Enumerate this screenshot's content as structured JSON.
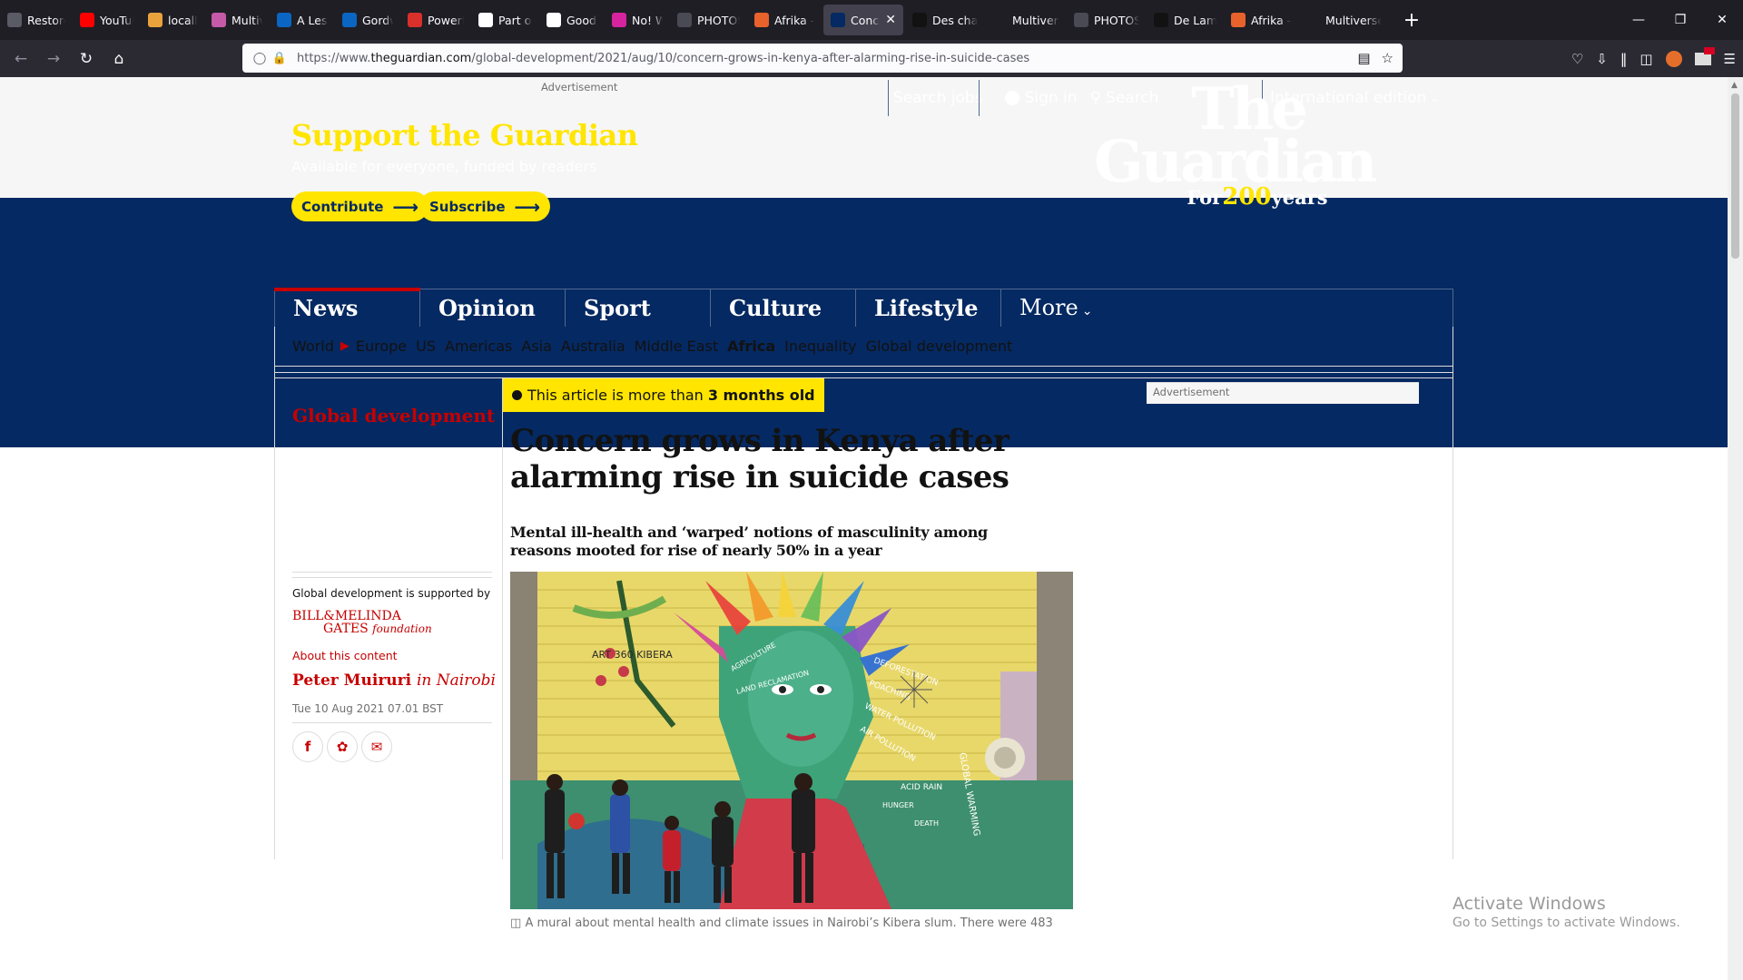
{
  "browser": {
    "tabs": [
      {
        "label": "Restore S",
        "icon": "info-icon",
        "color": "#5b5b66"
      },
      {
        "label": "YouTube",
        "icon": "youtube-icon",
        "color": "#ff0000"
      },
      {
        "label": "localhos",
        "icon": "localhost-icon",
        "color": "#e8a33d"
      },
      {
        "label": "Multiver",
        "icon": "multiverse-icon",
        "color": "#c659a8"
      },
      {
        "label": "A Lesson",
        "icon": "linkedin-icon",
        "color": "#0a66c2"
      },
      {
        "label": "Gordwin",
        "icon": "linkedin-icon",
        "color": "#0a66c2"
      },
      {
        "label": "Powerfu",
        "icon": "red-logo-icon",
        "color": "#d9302c"
      },
      {
        "label": "Part one",
        "icon": "medium-icon",
        "color": "#ffffff"
      },
      {
        "label": "Good Ne",
        "icon": "gc-icon",
        "color": "#ffffff"
      },
      {
        "label": "No! Wah",
        "icon": "instagram-icon",
        "color": "#d6249f"
      },
      {
        "label": "PHOTOS",
        "icon": "photos-icon",
        "color": "#4a4a55"
      },
      {
        "label": "Afrika - I",
        "icon": "blogger-icon",
        "color": "#e8622c"
      },
      {
        "label": "Conce",
        "icon": "guardian-icon",
        "color": "#052962",
        "active": true
      },
      {
        "label": "Des char",
        "icon": "f-icon",
        "color": "#121212"
      },
      {
        "label": "Multiverse b",
        "icon": "none",
        "color": "#1f1e25"
      },
      {
        "label": "PHOTOS",
        "icon": "photos-icon",
        "color": "#4a4a55"
      },
      {
        "label": "De Lamu",
        "icon": "m-icon",
        "color": "#121212"
      },
      {
        "label": "Afrika - I",
        "icon": "blogger-icon",
        "color": "#e8622c"
      },
      {
        "label": "Multiverse b",
        "icon": "none",
        "color": "#1f1e25"
      }
    ],
    "url_prefix": "https://www.",
    "url_domain": "theguardian.com",
    "url_path": "/global-development/2021/aug/10/concern-grows-in-kenya-after-alarming-rise-in-suicide-cases"
  },
  "ad_top": {
    "label": "Advertisement"
  },
  "header": {
    "support_title": "Support the Guardian",
    "support_sub": "Available for everyone, funded by readers",
    "contribute": "Contribute",
    "subscribe": "Subscribe",
    "search_jobs": "Search jobs",
    "sign_in": "Sign in",
    "search": "Search",
    "edition": "International edition",
    "logo_line1": "The",
    "logo_line2": "Guardian",
    "logo_for": "For",
    "logo_200": "200",
    "logo_years": "years"
  },
  "pillars": [
    "News",
    "Opinion",
    "Sport",
    "Culture",
    "Lifestyle"
  ],
  "pillar_more": "More",
  "subnav": {
    "first": "World",
    "items": [
      "Europe",
      "US",
      "Americas",
      "Asia",
      "Australia",
      "Middle East"
    ],
    "current": "Africa",
    "rest": [
      "Inequality",
      "Global development"
    ]
  },
  "article": {
    "section": "Global development",
    "age_prefix": "This article is more than",
    "age_value": "3 months old",
    "headline": "Concern grows in Kenya after alarming rise in suicide cases",
    "standfirst": "Mental ill-health and ‘warped’ notions of masculinity among reasons mooted for rise of nearly 50% in a year",
    "supported_by": "Global development is supported by",
    "sponsor_line1": "BILL&MELINDA",
    "sponsor_line2": "GATES",
    "sponsor_line3": "foundation",
    "about": "About this content",
    "author": "Peter Muiruri",
    "location": "in Nairobi",
    "date": "Tue 10 Aug 2021 07.01 BST",
    "caption": "A mural about mental health and climate issues in Nairobi’s Kibera slum. There were 483",
    "ad_right": "Advertisement"
  },
  "mural_words": [
    "ART 360 KIBERA",
    "DEFORESTATION",
    "POACHING",
    "WATER POLLUTION",
    "AIR POLLUTION",
    "ACID RAIN",
    "HUNGER",
    "DEATH",
    "GLOBAL WARMING",
    "AGRICULTURE",
    "LAND RECLAMATION"
  ],
  "colors": {
    "guardian_blue": "#052962",
    "yellow": "#ffe500",
    "red": "#c70000"
  },
  "windows_watermark": {
    "title": "Activate Windows",
    "sub": "Go to Settings to activate Windows."
  }
}
